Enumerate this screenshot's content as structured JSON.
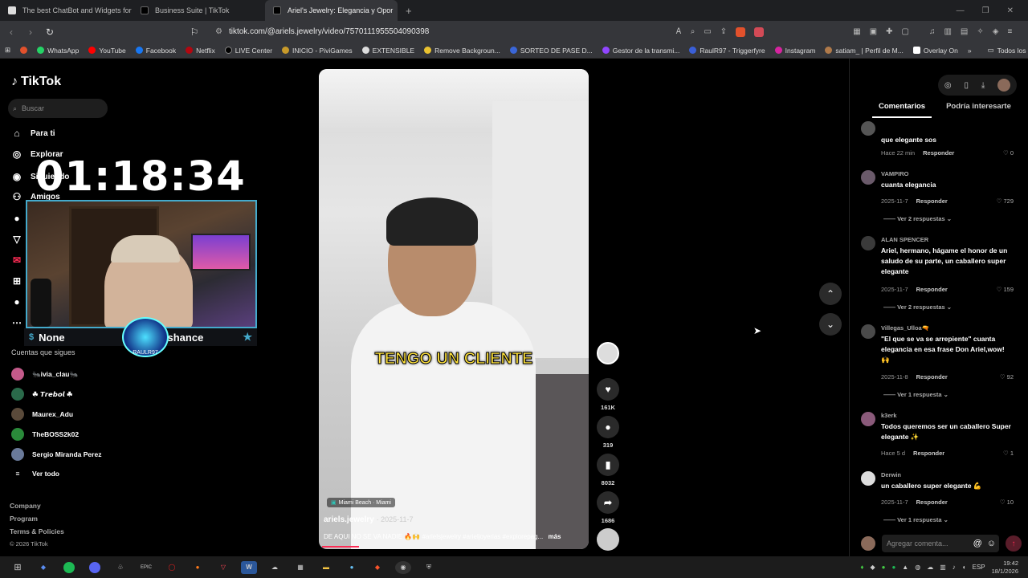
{
  "browser": {
    "tabs": [
      {
        "title": "The best ChatBot and Widgets for Ki",
        "active": false
      },
      {
        "title": "Business Suite | TikTok",
        "active": false
      },
      {
        "title": "Ariel's Jewelry: Elegancia y Opor",
        "active": true
      }
    ],
    "url": "tiktok.com/@ariels.jewelry/video/7570111955504090398",
    "bookmarks": [
      "WhatsApp",
      "YouTube",
      "Facebook",
      "Netflix",
      "LIVE Center",
      "INICIO - PiviGames",
      "EXTENSIBLE",
      "Remove Backgroun...",
      "SORTEO DE PASE D...",
      "Gestor de la transmi...",
      "RaulR97 - Triggerfyre",
      "Instagram",
      "satiam_ | Perfil de M...",
      "Overlay On"
    ],
    "bookmarks_folder": "Todos los favoritos"
  },
  "tiktok": {
    "logo": "TikTok",
    "search_placeholder": "Buscar",
    "nav": [
      "Para ti",
      "Explorar",
      "Siguiendo",
      "Amigos"
    ],
    "following_title": "Cuentas que sigues",
    "following": [
      "🐜ivia_clau🐜",
      "☘ 𝙏𝙧𝙚𝙗𝙤𝙡 ☘",
      "Maurex_Adu",
      "TheBOSS2k02",
      "Sergio Miranda Perez"
    ],
    "see_all": "Ver todo",
    "footer": [
      "Company",
      "Program",
      "Terms & Policies",
      "© 2026 TikTok"
    ]
  },
  "overlay": {
    "timer": "01:18:34",
    "left_name": "None",
    "right_name": "bushance",
    "badge": "RAULR97"
  },
  "video": {
    "caption": "TENGO UN CLIENTE",
    "location": "Miami Beach · Miami",
    "author": "ariels.jewelry",
    "date": "· 2025-11-7",
    "description": "DE AQUI NO SE VA NADIE 🔥🙌 #arielsjewelry #arieljoyerias #explorepag...",
    "more": "más",
    "likes": "161K",
    "comments": "319",
    "saves": "8032",
    "shares": "1686"
  },
  "panel": {
    "tabs": [
      "Comentarios",
      "Podría interesarte"
    ],
    "comments": [
      {
        "user": "",
        "text": "que elegante sos",
        "time": "Hace 22 min",
        "likes": "0",
        "replies": ""
      },
      {
        "user": "VAMPIRO",
        "text": "cuanta elegancia",
        "time": "2025-11-7",
        "likes": "729",
        "replies": "Ver 2 respuestas"
      },
      {
        "user": "ALAN SPENCER",
        "text": "Ariel, hermano, hágame el honor de un saludo de su parte, un caballero super elegante",
        "time": "2025-11-7",
        "likes": "159",
        "replies": "Ver 2 respuestas"
      },
      {
        "user": "Villegas_Ulloa🔫",
        "text": "\"El que se va se arrepiente\" cuanta elegancia en esa frase Don Ariel,wow!🙌",
        "time": "2025-11-8",
        "likes": "92",
        "replies": "Ver 1 respuesta"
      },
      {
        "user": "k3erk",
        "text": "Todos queremos ser un caballero Super elegante ✨",
        "time": "Hace 5 d",
        "likes": "1",
        "replies": ""
      },
      {
        "user": "Derwin",
        "text": "un caballero super elegante 💪",
        "time": "2025-11-7",
        "likes": "10",
        "replies": "Ver 1 respuesta"
      }
    ],
    "reply_label": "Responder",
    "comment_placeholder": "Agregar comenta..."
  },
  "taskbar": {
    "language": "ESP",
    "time": "19:42",
    "date": "18/1/2026"
  },
  "colors": {
    "accent": "#fe2c55",
    "caption": "#ffe23a"
  }
}
